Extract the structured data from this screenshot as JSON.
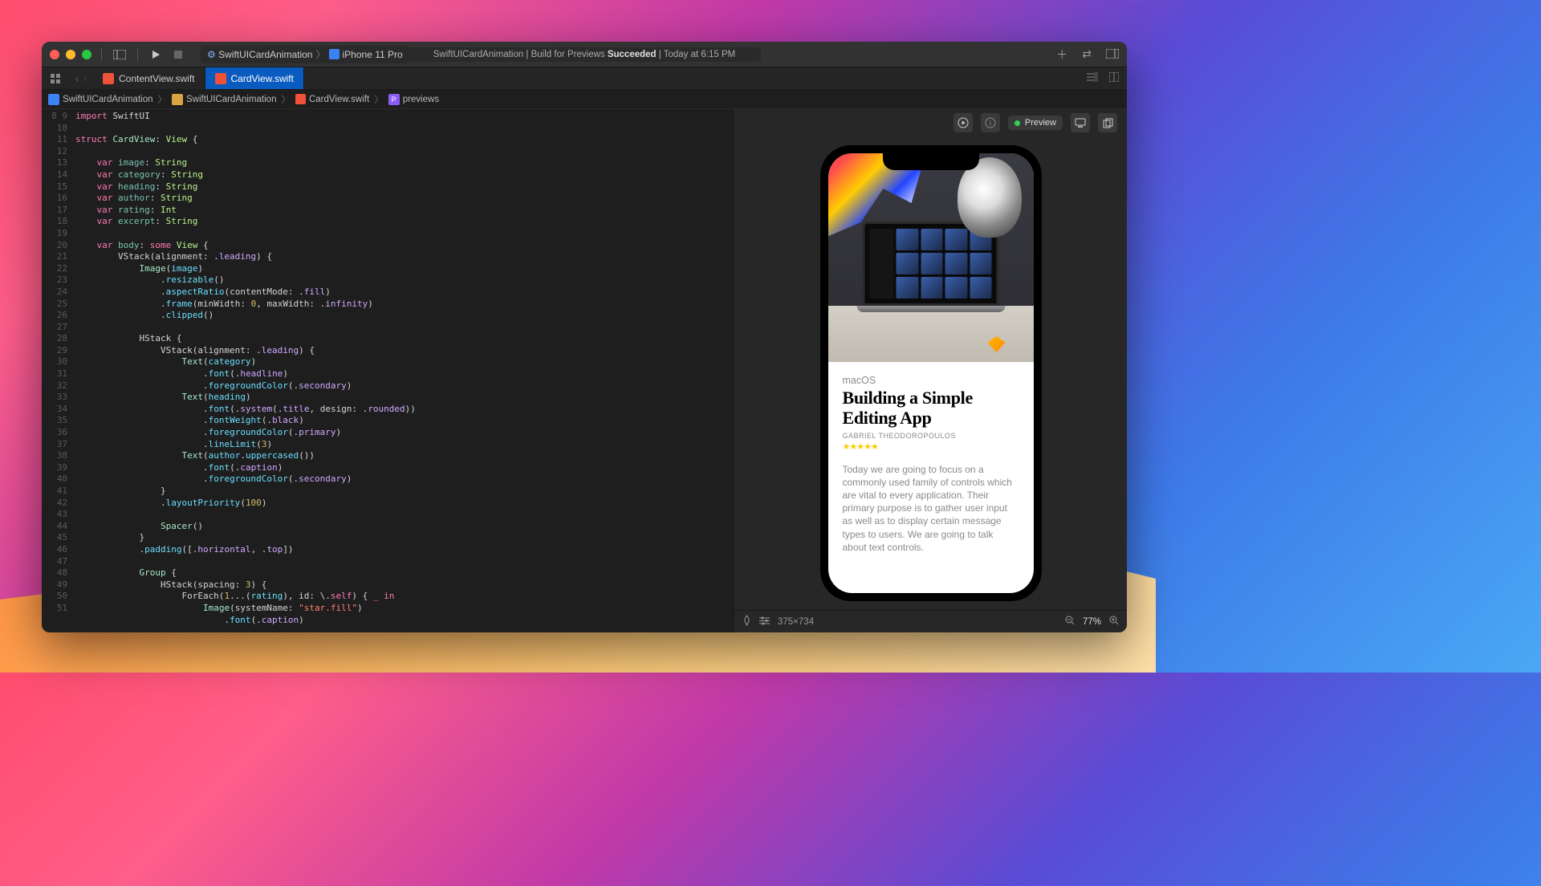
{
  "toolbar": {
    "scheme_project": "SwiftUICardAnimation",
    "scheme_device": "iPhone 11 Pro",
    "status_prefix": "SwiftUICardAnimation | Build for Previews ",
    "status_result": "Succeeded",
    "status_time": " | Today at 6:15 PM"
  },
  "tabs": [
    {
      "name": "ContentView.swift",
      "active": false
    },
    {
      "name": "CardView.swift",
      "active": true
    }
  ],
  "breadcrumb": {
    "items": [
      "SwiftUICardAnimation",
      "SwiftUICardAnimation",
      "CardView.swift",
      "previews"
    ]
  },
  "editor": {
    "first_line": 8,
    "lines": [
      [
        [
          "kw",
          "import"
        ],
        [
          "",
          " SwiftUI"
        ]
      ],
      [],
      [
        [
          "kw",
          "struct"
        ],
        [
          "",
          " "
        ],
        [
          "type",
          "CardView"
        ],
        [
          "",
          ": "
        ],
        [
          "ptype",
          "View"
        ],
        [
          "",
          " {"
        ]
      ],
      [],
      [
        [
          "",
          "    "
        ],
        [
          "kw",
          "var"
        ],
        [
          "",
          " "
        ],
        [
          "prop",
          "image"
        ],
        [
          "",
          ": "
        ],
        [
          "ptype",
          "String"
        ]
      ],
      [
        [
          "",
          "    "
        ],
        [
          "kw",
          "var"
        ],
        [
          "",
          " "
        ],
        [
          "prop",
          "category"
        ],
        [
          "",
          ": "
        ],
        [
          "ptype",
          "String"
        ]
      ],
      [
        [
          "",
          "    "
        ],
        [
          "kw",
          "var"
        ],
        [
          "",
          " "
        ],
        [
          "prop",
          "heading"
        ],
        [
          "",
          ": "
        ],
        [
          "ptype",
          "String"
        ]
      ],
      [
        [
          "",
          "    "
        ],
        [
          "kw",
          "var"
        ],
        [
          "",
          " "
        ],
        [
          "prop",
          "author"
        ],
        [
          "",
          ": "
        ],
        [
          "ptype",
          "String"
        ]
      ],
      [
        [
          "",
          "    "
        ],
        [
          "kw",
          "var"
        ],
        [
          "",
          " "
        ],
        [
          "prop",
          "rating"
        ],
        [
          "",
          ": "
        ],
        [
          "ptype",
          "Int"
        ]
      ],
      [
        [
          "",
          "    "
        ],
        [
          "kw",
          "var"
        ],
        [
          "",
          " "
        ],
        [
          "prop",
          "excerpt"
        ],
        [
          "",
          ": "
        ],
        [
          "ptype",
          "String"
        ]
      ],
      [],
      [
        [
          "",
          "    "
        ],
        [
          "kw",
          "var"
        ],
        [
          "",
          " "
        ],
        [
          "prop",
          "body"
        ],
        [
          "",
          ": "
        ],
        [
          "kw",
          "some"
        ],
        [
          "",
          " "
        ],
        [
          "ptype",
          "View"
        ],
        [
          "",
          " {"
        ]
      ],
      [
        [
          "",
          "        VStack(alignment: ."
        ],
        [
          "enum",
          "leading"
        ],
        [
          "",
          ") {"
        ]
      ],
      [
        [
          "",
          "            "
        ],
        [
          "type",
          "Image"
        ],
        [
          "",
          "("
        ],
        [
          "id",
          "image"
        ],
        [
          "",
          ")"
        ]
      ],
      [
        [
          "",
          "                ."
        ],
        [
          "id",
          "resizable"
        ],
        [
          "",
          "()"
        ]
      ],
      [
        [
          "",
          "                ."
        ],
        [
          "id",
          "aspectRatio"
        ],
        [
          "",
          "(contentMode: ."
        ],
        [
          "enum",
          "fill"
        ],
        [
          "",
          ")"
        ]
      ],
      [
        [
          "",
          "                ."
        ],
        [
          "id",
          "frame"
        ],
        [
          "",
          "(minWidth: "
        ],
        [
          "num",
          "0"
        ],
        [
          "",
          ", maxWidth: ."
        ],
        [
          "enum",
          "infinity"
        ],
        [
          "",
          ")"
        ]
      ],
      [
        [
          "",
          "                ."
        ],
        [
          "id",
          "clipped"
        ],
        [
          "",
          "()"
        ]
      ],
      [],
      [
        [
          "",
          "            HStack {"
        ]
      ],
      [
        [
          "",
          "                VStack(alignment: ."
        ],
        [
          "enum",
          "leading"
        ],
        [
          "",
          ") {"
        ]
      ],
      [
        [
          "",
          "                    "
        ],
        [
          "type",
          "Text"
        ],
        [
          "",
          "("
        ],
        [
          "id",
          "category"
        ],
        [
          "",
          ")"
        ]
      ],
      [
        [
          "",
          "                        ."
        ],
        [
          "id",
          "font"
        ],
        [
          "",
          "(."
        ],
        [
          "enum",
          "headline"
        ],
        [
          "",
          ")"
        ]
      ],
      [
        [
          "",
          "                        ."
        ],
        [
          "id",
          "foregroundColor"
        ],
        [
          "",
          "(."
        ],
        [
          "enum",
          "secondary"
        ],
        [
          "",
          ")"
        ]
      ],
      [
        [
          "",
          "                    "
        ],
        [
          "type",
          "Text"
        ],
        [
          "",
          "("
        ],
        [
          "id",
          "heading"
        ],
        [
          "",
          ")"
        ]
      ],
      [
        [
          "",
          "                        ."
        ],
        [
          "id",
          "font"
        ],
        [
          "",
          "(."
        ],
        [
          "enum",
          "system"
        ],
        [
          "",
          "(."
        ],
        [
          "enum",
          "title"
        ],
        [
          "",
          ", design: ."
        ],
        [
          "enum",
          "rounded"
        ],
        [
          "",
          "))"
        ]
      ],
      [
        [
          "",
          "                        ."
        ],
        [
          "id",
          "fontWeight"
        ],
        [
          "",
          "(."
        ],
        [
          "enum",
          "black"
        ],
        [
          "",
          ")"
        ]
      ],
      [
        [
          "",
          "                        ."
        ],
        [
          "id",
          "foregroundColor"
        ],
        [
          "",
          "(."
        ],
        [
          "enum",
          "primary"
        ],
        [
          "",
          ")"
        ]
      ],
      [
        [
          "",
          "                        ."
        ],
        [
          "id",
          "lineLimit"
        ],
        [
          "",
          "("
        ],
        [
          "num",
          "3"
        ],
        [
          "",
          ")"
        ]
      ],
      [
        [
          "",
          "                    "
        ],
        [
          "type",
          "Text"
        ],
        [
          "",
          "("
        ],
        [
          "id",
          "author"
        ],
        [
          "",
          "."
        ],
        [
          "id",
          "uppercased"
        ],
        [
          "",
          "())"
        ]
      ],
      [
        [
          "",
          "                        ."
        ],
        [
          "id",
          "font"
        ],
        [
          "",
          "(."
        ],
        [
          "enum",
          "caption"
        ],
        [
          "",
          ")"
        ]
      ],
      [
        [
          "",
          "                        ."
        ],
        [
          "id",
          "foregroundColor"
        ],
        [
          "",
          "(."
        ],
        [
          "enum",
          "secondary"
        ],
        [
          "",
          ")"
        ]
      ],
      [
        [
          "",
          "                }"
        ]
      ],
      [
        [
          "",
          "                ."
        ],
        [
          "id",
          "layoutPriority"
        ],
        [
          "",
          "("
        ],
        [
          "num",
          "100"
        ],
        [
          "",
          ")"
        ]
      ],
      [],
      [
        [
          "",
          "                "
        ],
        [
          "type",
          "Spacer"
        ],
        [
          "",
          "()"
        ]
      ],
      [
        [
          "",
          "            }"
        ]
      ],
      [
        [
          "",
          "            ."
        ],
        [
          "id",
          "padding"
        ],
        [
          "",
          "([."
        ],
        [
          "enum",
          "horizontal"
        ],
        [
          "",
          ", ."
        ],
        [
          "enum",
          "top"
        ],
        [
          "",
          "])"
        ]
      ],
      [],
      [
        [
          "",
          "            "
        ],
        [
          "type",
          "Group"
        ],
        [
          "",
          " {"
        ]
      ],
      [
        [
          "",
          "                HStack(spacing: "
        ],
        [
          "num",
          "3"
        ],
        [
          "",
          ") {"
        ]
      ],
      [
        [
          "",
          "                    ForEach("
        ],
        [
          "num",
          "1"
        ],
        [
          "",
          "...("
        ],
        [
          "id",
          "rating"
        ],
        [
          "",
          "), id: \\."
        ],
        [
          "kw",
          "self"
        ],
        [
          "",
          ") { "
        ],
        [
          "kw",
          "_"
        ],
        [
          "",
          " "
        ],
        [
          "kw",
          "in"
        ]
      ],
      [
        [
          "",
          "                        "
        ],
        [
          "type",
          "Image"
        ],
        [
          "",
          "(systemName: "
        ],
        [
          "str",
          "\"star.fill\""
        ],
        [
          "",
          ")"
        ]
      ],
      [
        [
          "",
          "                            ."
        ],
        [
          "id",
          "font"
        ],
        [
          "",
          "(."
        ],
        [
          "enum",
          "caption"
        ],
        [
          "",
          ")"
        ]
      ]
    ]
  },
  "preview": {
    "label": "Preview",
    "card": {
      "category": "macOS",
      "heading": "Building a Simple Editing App",
      "author": "GABRIEL THEODOROPOULOS",
      "stars": "★★★★★",
      "excerpt": "Today we are going to focus on a commonly used family of controls which are vital to every application. Their primary purpose is to gather user input as well as to display certain message types to users. We are going to talk about text controls."
    },
    "footer": {
      "dimensions": "375×734",
      "zoom": "77%"
    }
  }
}
